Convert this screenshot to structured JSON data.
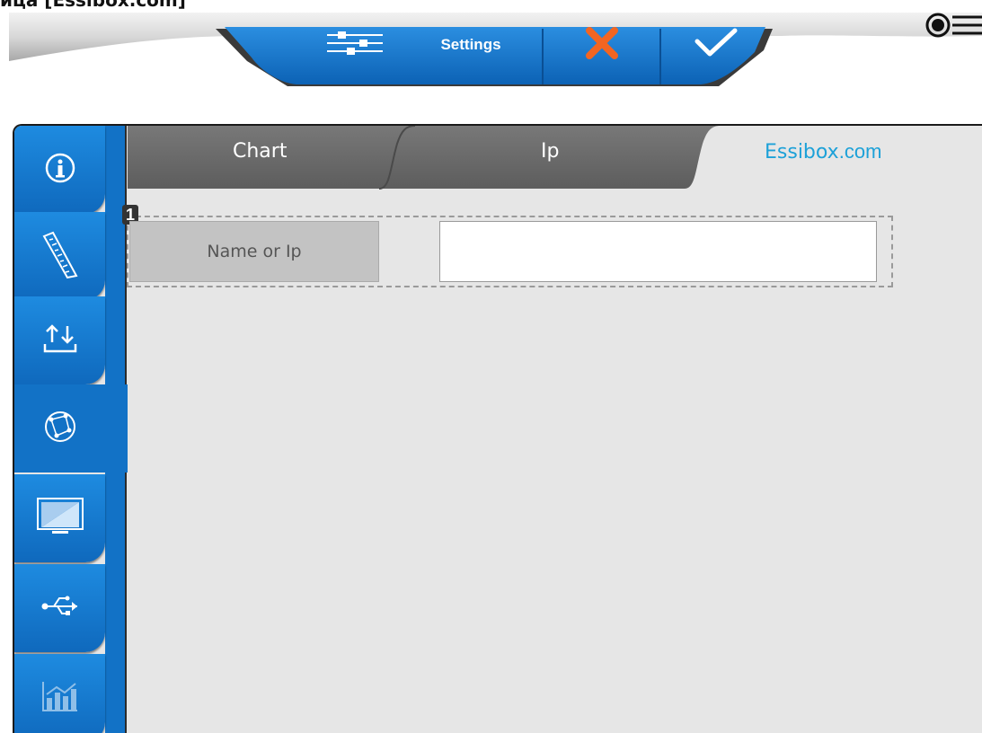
{
  "window": {
    "title": "ица [Essibox.com]"
  },
  "toolbar": {
    "settings_label": "Settings",
    "icons": [
      "sliders-icon",
      "cancel-x-icon",
      "confirm-check-icon",
      "menu-icon"
    ]
  },
  "sidebar": {
    "items": [
      {
        "name": "info",
        "icon": "info-icon"
      },
      {
        "name": "measure",
        "icon": "ruler-icon"
      },
      {
        "name": "transfer",
        "icon": "upload-download-icon"
      },
      {
        "name": "network",
        "icon": "network-globe-icon",
        "active": true
      },
      {
        "name": "display",
        "icon": "monitor-icon"
      },
      {
        "name": "usb",
        "icon": "usb-icon"
      },
      {
        "name": "statistics",
        "icon": "chart-icon"
      }
    ]
  },
  "tabs": [
    {
      "label": "Chart"
    },
    {
      "label": "Ip"
    },
    {
      "label_main": "Essibox",
      "label_tld": ".com",
      "active": true
    }
  ],
  "form": {
    "row_number": "1",
    "field_label": "Name or Ip",
    "field_value": ""
  },
  "colors": {
    "accent_blue": "#1272c6",
    "cancel_orange": "#f26522",
    "brand_cyan": "#1da1d8",
    "panel_bg": "#e6e6e6",
    "tab_gray": "#6d6d6d"
  }
}
